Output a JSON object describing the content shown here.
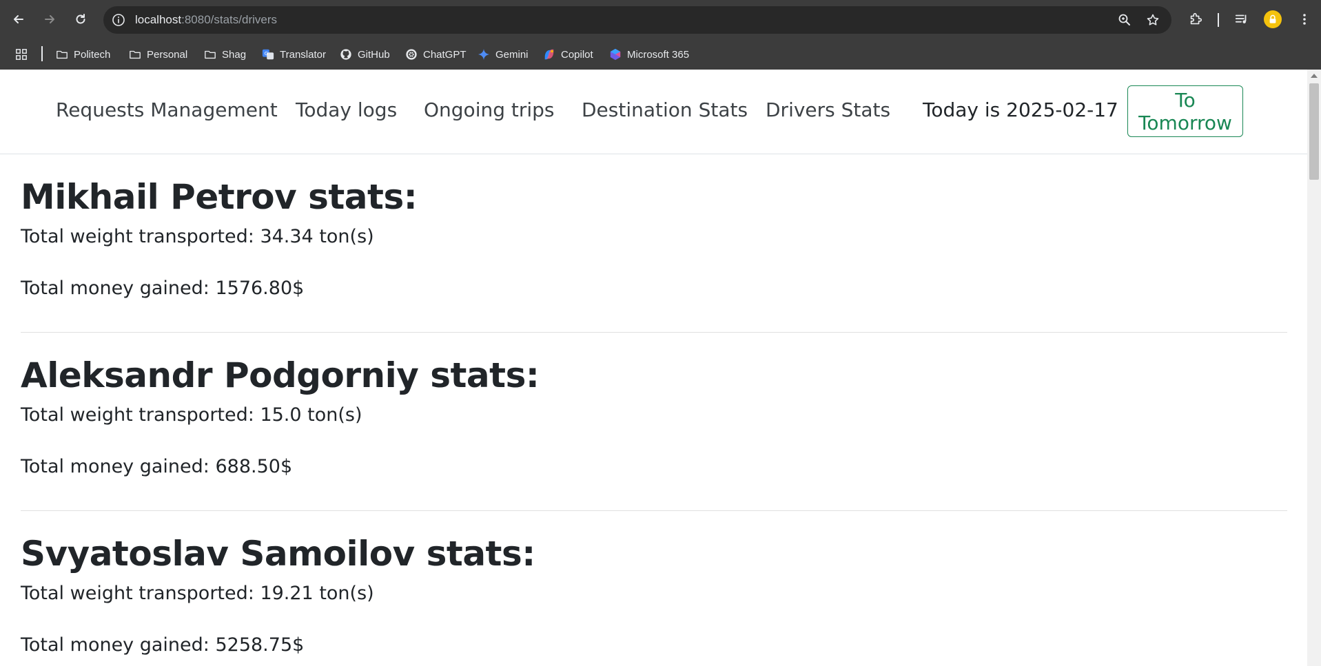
{
  "browser": {
    "url_host": "localhost",
    "url_path": ":8080/stats/drivers",
    "bookmarks": [
      {
        "label": "Politech",
        "icon": "folder-icon"
      },
      {
        "label": "Personal",
        "icon": "folder-icon"
      },
      {
        "label": "Shag",
        "icon": "folder-icon"
      },
      {
        "label": "Translator",
        "icon": "translate-icon"
      },
      {
        "label": "GitHub",
        "icon": "github-icon"
      },
      {
        "label": "ChatGPT",
        "icon": "chatgpt-icon"
      },
      {
        "label": "Gemini",
        "icon": "gemini-icon"
      },
      {
        "label": "Copilot",
        "icon": "copilot-icon"
      },
      {
        "label": "Microsoft 365",
        "icon": "microsoft365-icon"
      }
    ]
  },
  "nav": {
    "links": [
      "Requests Management",
      "Today logs",
      "Ongoing trips",
      "Destination Stats",
      "Drivers Stats"
    ],
    "today": "Today is 2025-02-17",
    "tomorrow_button": "To Tomorrow"
  },
  "drivers": [
    {
      "title": "Mikhail Petrov stats:",
      "weight": "Total weight transported: 34.34 ton(s)",
      "money": "Total money gained: 1576.80$"
    },
    {
      "title": "Aleksandr Podgorniy stats:",
      "weight": "Total weight transported: 15.0 ton(s)",
      "money": "Total money gained: 688.50$"
    },
    {
      "title": "Svyatoslav Samoilov stats:",
      "weight": "Total weight transported: 19.21 ton(s)",
      "money": "Total money gained: 5258.75$"
    }
  ],
  "colors": {
    "chrome_bg": "#3c3c3c",
    "omnibox_bg": "#282828",
    "success": "#198754",
    "text": "#212529"
  }
}
